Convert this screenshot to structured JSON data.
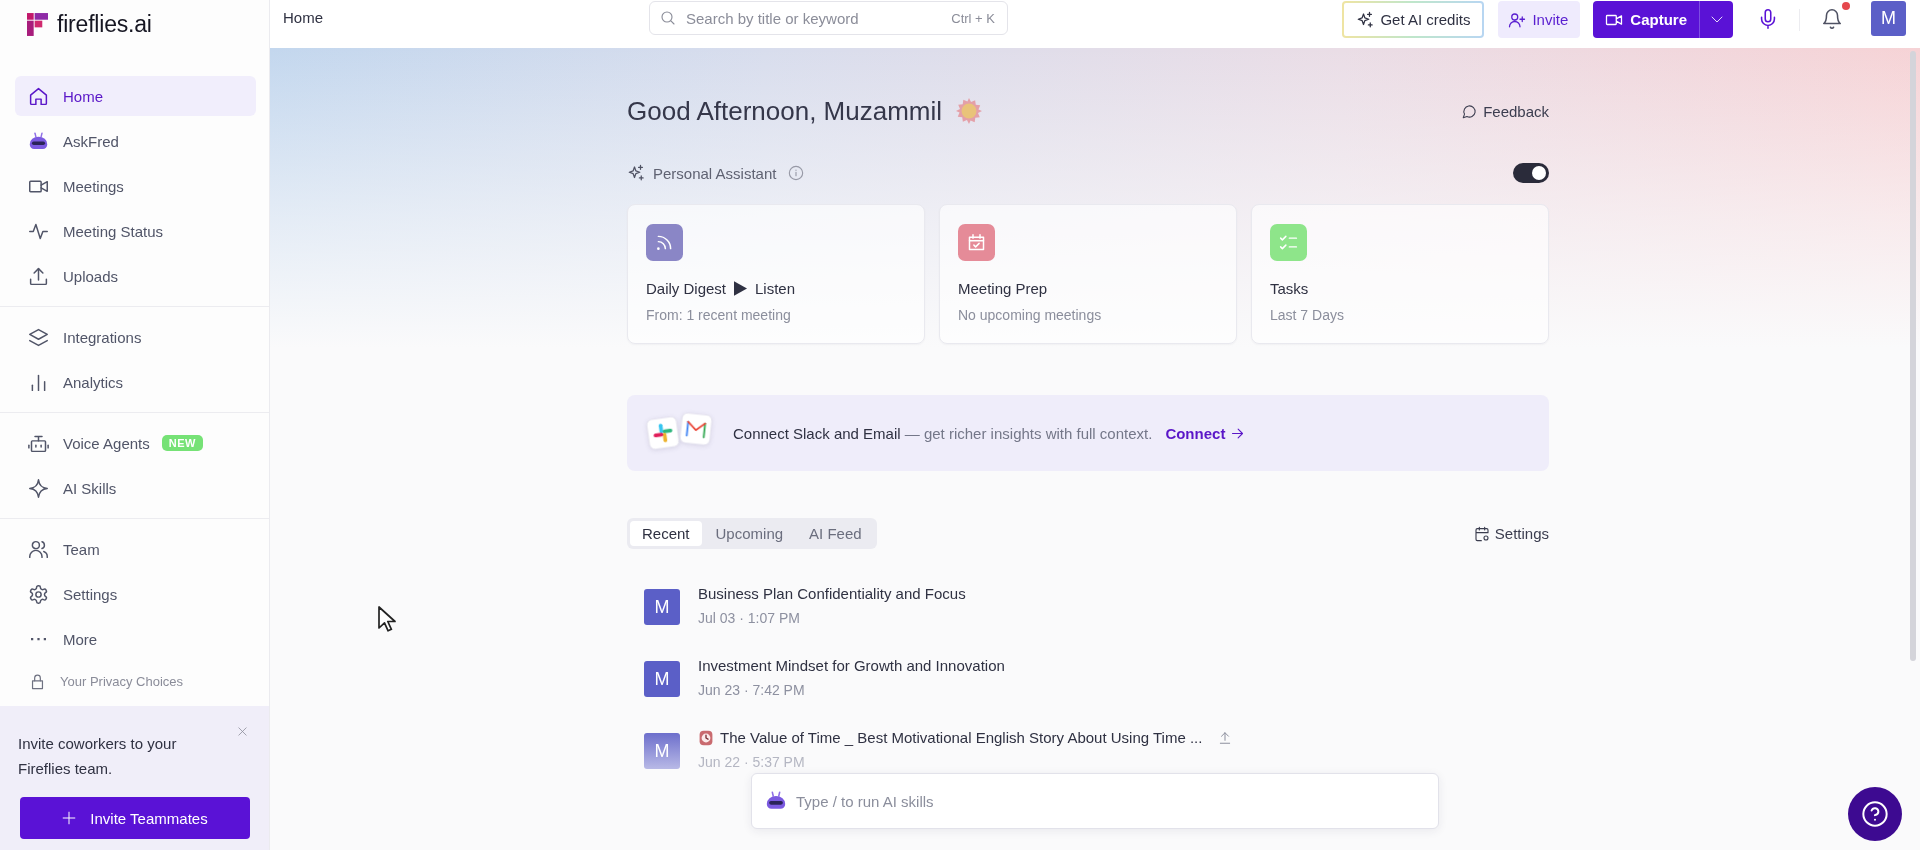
{
  "sidebar": {
    "logo": "fireflies.ai",
    "sections": [
      {
        "items": [
          {
            "label": "Home",
            "selected": true
          },
          {
            "label": "AskFred",
            "selected": false
          },
          {
            "label": "Meetings",
            "selected": false
          },
          {
            "label": "Meeting Status",
            "selected": false
          },
          {
            "label": "Uploads",
            "selected": false
          }
        ]
      },
      {
        "items": [
          {
            "label": "Integrations",
            "selected": false
          },
          {
            "label": "Analytics",
            "selected": false
          }
        ]
      },
      {
        "items": [
          {
            "label": "Voice Agents",
            "selected": false,
            "badge": "NEW"
          },
          {
            "label": "AI Skills",
            "selected": false
          }
        ]
      },
      {
        "items": [
          {
            "label": "Team",
            "selected": false
          },
          {
            "label": "Settings",
            "selected": false
          },
          {
            "label": "More",
            "selected": false
          }
        ]
      }
    ],
    "privacy_link": "Your Privacy Choices",
    "invite_panel": {
      "text": "Invite coworkers to your Fireflies team.",
      "button": "Invite Teammates"
    }
  },
  "top_bar": {
    "breadcrumb": "Home",
    "search": {
      "placeholder": "Search by title or keyword",
      "shortcut": "Ctrl + K"
    },
    "credits_button": "Get AI credits",
    "invite_button": "Invite",
    "capture_button": "Capture",
    "notifications_unread": true,
    "avatar": "M"
  },
  "greeting": {
    "title": "Good Afternoon, Muzammil",
    "feedback": "Feedback"
  },
  "assistant": {
    "label": "Personal Assistant",
    "on": true,
    "cards": [
      {
        "title": "Daily Digest",
        "action": "Listen",
        "subtitle": "From: 1 recent meeting",
        "color": "#8a86c6"
      },
      {
        "title": "Meeting Prep",
        "subtitle": "No upcoming meetings",
        "color": "#e58b98"
      },
      {
        "title": "Tasks",
        "subtitle": "Last 7 Days",
        "color": "#8ee58a"
      }
    ]
  },
  "connect_banner": {
    "text": "**Connect Slack and Email** — get richer insights with full context.",
    "link": "Connect"
  },
  "meetings": {
    "tabs": [
      {
        "label": "Recent",
        "selected": true
      },
      {
        "label": "Upcoming",
        "selected": false
      },
      {
        "label": "AI Feed",
        "selected": false
      }
    ],
    "settings": "Settings",
    "rows": [
      {
        "avatar": "M",
        "title": "Business Plan Confidentiality and Focus",
        "date": "Jul 03 · 1:07 PM",
        "leading_icon": false,
        "uploaded": false
      },
      {
        "avatar": "M",
        "title": "Investment Mindset for Growth and Innovation",
        "date": "Jun 23 · 7:42 PM",
        "leading_icon": false,
        "uploaded": false
      },
      {
        "avatar": "M",
        "title": "The Value of Time _ Best Motivational English Story About Using Time ...",
        "date": "Jun 22 · 5:37 PM",
        "leading_icon": true,
        "uploaded": true
      }
    ]
  },
  "ai_input": {
    "placeholder": "Type / to run AI skills"
  }
}
